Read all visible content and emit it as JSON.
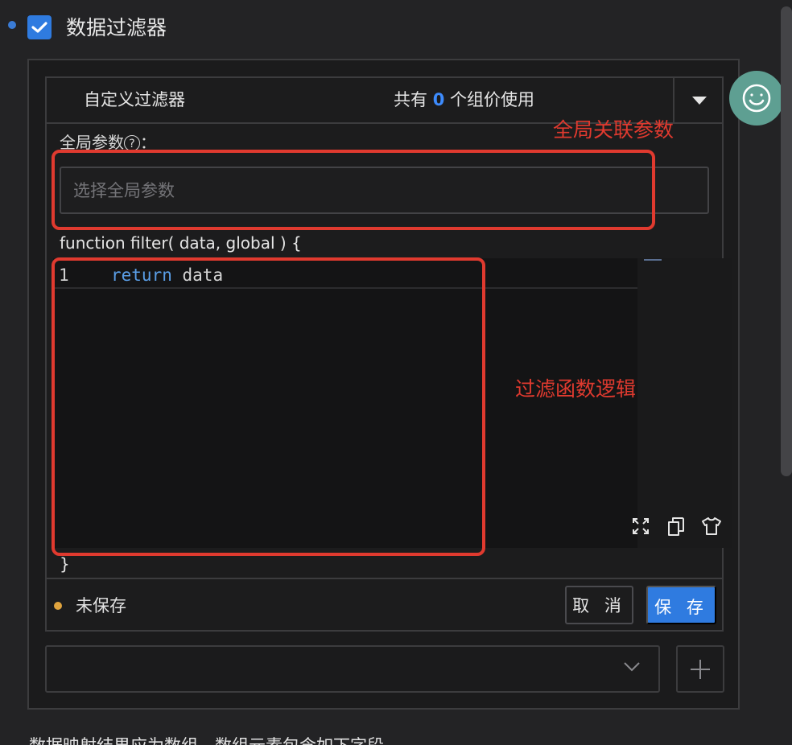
{
  "header": {
    "checkbox_checked": true,
    "title": "数据过滤器"
  },
  "filter": {
    "name": "自定义过滤器",
    "usage_prefix": "共有",
    "usage_count": "0",
    "usage_suffix": "个组价使用",
    "global_label": "全局参数",
    "global_colon": "：",
    "help_glyph": "?",
    "global_placeholder": "选择全局参数",
    "function_signature": "function filter( data, global ) {",
    "code": {
      "line_number": "1",
      "keyword": "return",
      "value": "data"
    },
    "closing_brace": "}"
  },
  "footer": {
    "status": "未保存",
    "status_color": "#e0a43e",
    "cancel_label": "取 消",
    "save_label": "保 存"
  },
  "bottom_text": "数据映射结果应为数组，数组元素包含如下字段",
  "annotations": {
    "global_params": "全局关联参数",
    "filter_logic": "过滤函数逻辑"
  },
  "colors": {
    "accent": "#2f7be0",
    "annotation": "#e03a2f",
    "smiley": "#5e9f92"
  },
  "icons": [
    "check-icon",
    "caret-down-icon",
    "help-icon",
    "fullscreen-icon",
    "copy-icon",
    "shirt-icon",
    "chevron-down-icon",
    "plus-icon",
    "smiley-icon"
  ]
}
